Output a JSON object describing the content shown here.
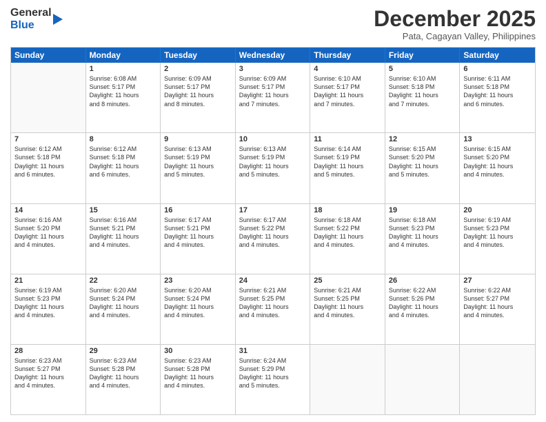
{
  "logo": {
    "line1": "General",
    "line2": "Blue"
  },
  "title": "December 2025",
  "subtitle": "Pata, Cagayan Valley, Philippines",
  "header_days": [
    "Sunday",
    "Monday",
    "Tuesday",
    "Wednesday",
    "Thursday",
    "Friday",
    "Saturday"
  ],
  "rows": [
    [
      {
        "day": "",
        "text": ""
      },
      {
        "day": "1",
        "text": "Sunrise: 6:08 AM\nSunset: 5:17 PM\nDaylight: 11 hours\nand 8 minutes."
      },
      {
        "day": "2",
        "text": "Sunrise: 6:09 AM\nSunset: 5:17 PM\nDaylight: 11 hours\nand 8 minutes."
      },
      {
        "day": "3",
        "text": "Sunrise: 6:09 AM\nSunset: 5:17 PM\nDaylight: 11 hours\nand 7 minutes."
      },
      {
        "day": "4",
        "text": "Sunrise: 6:10 AM\nSunset: 5:17 PM\nDaylight: 11 hours\nand 7 minutes."
      },
      {
        "day": "5",
        "text": "Sunrise: 6:10 AM\nSunset: 5:18 PM\nDaylight: 11 hours\nand 7 minutes."
      },
      {
        "day": "6",
        "text": "Sunrise: 6:11 AM\nSunset: 5:18 PM\nDaylight: 11 hours\nand 6 minutes."
      }
    ],
    [
      {
        "day": "7",
        "text": "Sunrise: 6:12 AM\nSunset: 5:18 PM\nDaylight: 11 hours\nand 6 minutes."
      },
      {
        "day": "8",
        "text": "Sunrise: 6:12 AM\nSunset: 5:18 PM\nDaylight: 11 hours\nand 6 minutes."
      },
      {
        "day": "9",
        "text": "Sunrise: 6:13 AM\nSunset: 5:19 PM\nDaylight: 11 hours\nand 5 minutes."
      },
      {
        "day": "10",
        "text": "Sunrise: 6:13 AM\nSunset: 5:19 PM\nDaylight: 11 hours\nand 5 minutes."
      },
      {
        "day": "11",
        "text": "Sunrise: 6:14 AM\nSunset: 5:19 PM\nDaylight: 11 hours\nand 5 minutes."
      },
      {
        "day": "12",
        "text": "Sunrise: 6:15 AM\nSunset: 5:20 PM\nDaylight: 11 hours\nand 5 minutes."
      },
      {
        "day": "13",
        "text": "Sunrise: 6:15 AM\nSunset: 5:20 PM\nDaylight: 11 hours\nand 4 minutes."
      }
    ],
    [
      {
        "day": "14",
        "text": "Sunrise: 6:16 AM\nSunset: 5:20 PM\nDaylight: 11 hours\nand 4 minutes."
      },
      {
        "day": "15",
        "text": "Sunrise: 6:16 AM\nSunset: 5:21 PM\nDaylight: 11 hours\nand 4 minutes."
      },
      {
        "day": "16",
        "text": "Sunrise: 6:17 AM\nSunset: 5:21 PM\nDaylight: 11 hours\nand 4 minutes."
      },
      {
        "day": "17",
        "text": "Sunrise: 6:17 AM\nSunset: 5:22 PM\nDaylight: 11 hours\nand 4 minutes."
      },
      {
        "day": "18",
        "text": "Sunrise: 6:18 AM\nSunset: 5:22 PM\nDaylight: 11 hours\nand 4 minutes."
      },
      {
        "day": "19",
        "text": "Sunrise: 6:18 AM\nSunset: 5:23 PM\nDaylight: 11 hours\nand 4 minutes."
      },
      {
        "day": "20",
        "text": "Sunrise: 6:19 AM\nSunset: 5:23 PM\nDaylight: 11 hours\nand 4 minutes."
      }
    ],
    [
      {
        "day": "21",
        "text": "Sunrise: 6:19 AM\nSunset: 5:23 PM\nDaylight: 11 hours\nand 4 minutes."
      },
      {
        "day": "22",
        "text": "Sunrise: 6:20 AM\nSunset: 5:24 PM\nDaylight: 11 hours\nand 4 minutes."
      },
      {
        "day": "23",
        "text": "Sunrise: 6:20 AM\nSunset: 5:24 PM\nDaylight: 11 hours\nand 4 minutes."
      },
      {
        "day": "24",
        "text": "Sunrise: 6:21 AM\nSunset: 5:25 PM\nDaylight: 11 hours\nand 4 minutes."
      },
      {
        "day": "25",
        "text": "Sunrise: 6:21 AM\nSunset: 5:25 PM\nDaylight: 11 hours\nand 4 minutes."
      },
      {
        "day": "26",
        "text": "Sunrise: 6:22 AM\nSunset: 5:26 PM\nDaylight: 11 hours\nand 4 minutes."
      },
      {
        "day": "27",
        "text": "Sunrise: 6:22 AM\nSunset: 5:27 PM\nDaylight: 11 hours\nand 4 minutes."
      }
    ],
    [
      {
        "day": "28",
        "text": "Sunrise: 6:23 AM\nSunset: 5:27 PM\nDaylight: 11 hours\nand 4 minutes."
      },
      {
        "day": "29",
        "text": "Sunrise: 6:23 AM\nSunset: 5:28 PM\nDaylight: 11 hours\nand 4 minutes."
      },
      {
        "day": "30",
        "text": "Sunrise: 6:23 AM\nSunset: 5:28 PM\nDaylight: 11 hours\nand 4 minutes."
      },
      {
        "day": "31",
        "text": "Sunrise: 6:24 AM\nSunset: 5:29 PM\nDaylight: 11 hours\nand 5 minutes."
      },
      {
        "day": "",
        "text": ""
      },
      {
        "day": "",
        "text": ""
      },
      {
        "day": "",
        "text": ""
      }
    ]
  ]
}
